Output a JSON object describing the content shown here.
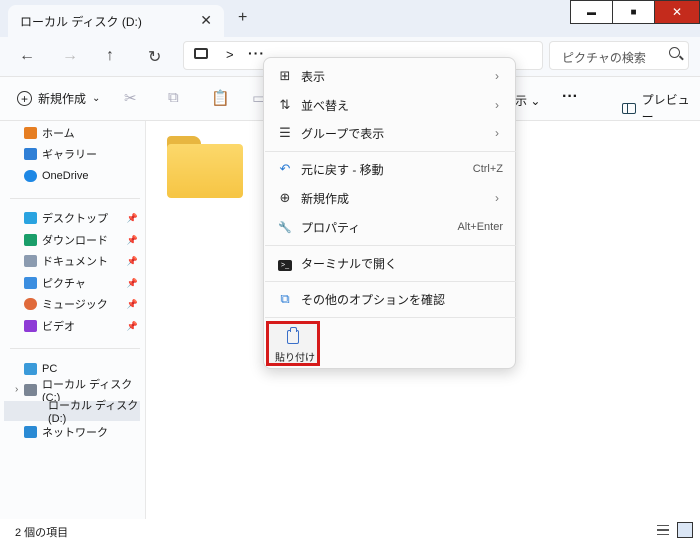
{
  "window": {
    "tab_title": "ローカル ディスク (D:)",
    "tab_close": "✕",
    "new_tab": "+",
    "minimize": "▬",
    "maximize": "■",
    "close": "✕"
  },
  "nav": {
    "back": "←",
    "forward": "→",
    "up": "↑",
    "refresh": "↻",
    "breadcrumb_chevron": ">",
    "breadcrumb_more": "···",
    "search_placeholder": "ピクチャの検索"
  },
  "toolbar": {
    "new_label": "新規作成",
    "new_caret": "⌄",
    "sort_fragment": "示 ⌄",
    "more": "···",
    "preview_label": "プレビュー"
  },
  "sidebar": {
    "quick": [
      {
        "label": "ホーム",
        "icon": "home-icon",
        "color": "#e67e22"
      },
      {
        "label": "ギャラリー",
        "icon": "gallery-icon",
        "color": "#2f7fd6"
      },
      {
        "label": "OneDrive",
        "icon": "cloud-icon",
        "color": "#1e88e5"
      }
    ],
    "pinned": [
      {
        "label": "デスクトップ",
        "icon": "desktop-icon",
        "color": "#2aa3e0"
      },
      {
        "label": "ダウンロード",
        "icon": "download-icon",
        "color": "#1a9e6a"
      },
      {
        "label": "ドキュメント",
        "icon": "document-icon",
        "color": "#8b9bb0"
      },
      {
        "label": "ピクチャ",
        "icon": "pictures-icon",
        "color": "#3b8ee0"
      },
      {
        "label": "ミュージック",
        "icon": "music-icon",
        "color": "#e06a3b"
      },
      {
        "label": "ビデオ",
        "icon": "video-icon",
        "color": "#8e3bd6"
      }
    ],
    "pc": "PC",
    "disk_c": "ローカル ディスク (C:)",
    "disk_d": "ローカル ディスク (D:)",
    "network": "ネットワーク",
    "pin_glyph": "📌"
  },
  "context_menu": {
    "items": [
      {
        "label": "表示",
        "icon": "grid-view-icon",
        "glyph": "⊞",
        "arrow": "›"
      },
      {
        "label": "並べ替え",
        "icon": "sort-icon",
        "glyph": "⇅",
        "arrow": "›"
      },
      {
        "label": "グループで表示",
        "icon": "group-by-icon",
        "glyph": "☰",
        "arrow": "›"
      },
      {
        "label": "元に戻す - 移動",
        "icon": "undo-icon",
        "glyph": "↶",
        "shortcut": "Ctrl+Z"
      },
      {
        "label": "新規作成",
        "icon": "new-icon",
        "glyph": "⊕",
        "arrow": "›"
      },
      {
        "label": "プロパティ",
        "icon": "wrench-icon",
        "glyph": "🔧",
        "shortcut": "Alt+Enter"
      },
      {
        "label": "ターミナルで開く",
        "icon": "terminal-icon",
        "glyph": ">_"
      },
      {
        "label": "その他のオプションを確認",
        "icon": "more-options-icon",
        "glyph": "⧉"
      }
    ],
    "paste_label": "貼り付け"
  },
  "status": {
    "item_count": "2 個の項目"
  }
}
